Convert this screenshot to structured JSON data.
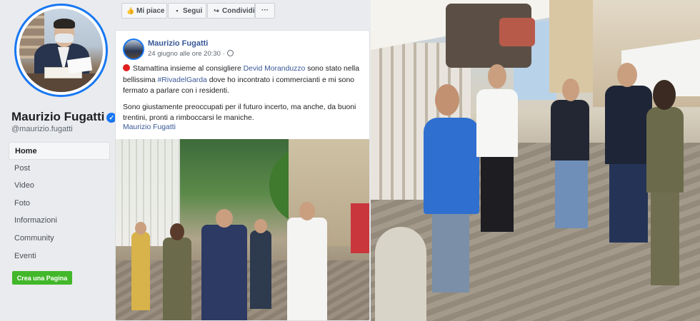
{
  "page": {
    "name": "Maurizio Fugatti",
    "handle": "@maurizio.fugatti",
    "verified_glyph": "✓",
    "nav": [
      "Home",
      "Post",
      "Video",
      "Foto",
      "Informazioni",
      "Community",
      "Eventi"
    ],
    "active_nav": "Home",
    "create_page_label": "Crea una Pagina"
  },
  "actions": {
    "like_label": "Mi piace",
    "follow_label": "Segui",
    "share_label": "Condividi",
    "more_label": "···",
    "icons": [
      "like-icon",
      "follow-icon",
      "share-icon",
      "more-icon"
    ]
  },
  "post": {
    "author": "Maurizio Fugatti",
    "date": "24 giugno alle ore 20:30 ·",
    "text1_a": "Stamattina insieme al consigliere ",
    "mention": "Devid Moranduzzo",
    "text1_b": " sono stato nella bellissima ",
    "hashtag": "#RivadelGarda",
    "text1_c": " dove ho incontrato i commercianti e mi sono fermato a parlare con i residenti.",
    "text2": "Sono giustamente preoccupati per il futuro incerto, ma anche, da buoni trentini, pronti a rimboccarsi le maniche.",
    "signature": "Maurizio Fugatti"
  },
  "colors": {
    "brand_blue": "#1877f2",
    "link_blue": "#385898",
    "create_green": "#42b72a",
    "emoji_red": "#e02020",
    "background": "#e9ebee"
  }
}
